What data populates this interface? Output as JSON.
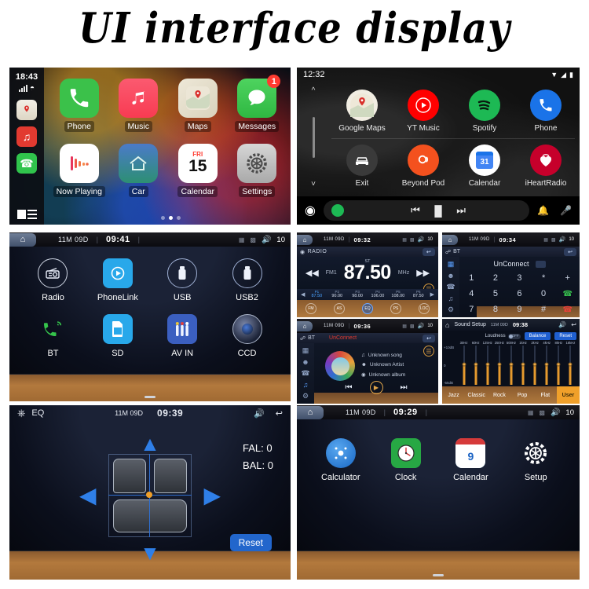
{
  "title": "UI interface display",
  "carplay": {
    "time": "18:43",
    "rail_icons": [
      "maps-icon",
      "netease-music-icon",
      "phone-icon",
      "list-icon"
    ],
    "apps": [
      {
        "label": "Phone",
        "icon": "phone-icon",
        "color": "#3bc14a",
        "badge": null
      },
      {
        "label": "Music",
        "icon": "music-note-icon",
        "color": "#fa4a5c",
        "badge": null
      },
      {
        "label": "Maps",
        "icon": "map-pin-icon",
        "color": "#f3efe4",
        "badge": null
      },
      {
        "label": "Messages",
        "icon": "chat-bubble-icon",
        "color": "#3bc14a",
        "badge": "1"
      },
      {
        "label": "Now Playing",
        "icon": "waveform-icon",
        "color": "#ffffff",
        "badge": null
      },
      {
        "label": "Car",
        "icon": "home-car-icon",
        "color": "#2f8f6a",
        "badge": null
      },
      {
        "label": "Calendar",
        "icon": "calendar-icon",
        "color": "#ffffff",
        "badge": null
      },
      {
        "label": "Settings",
        "icon": "gear-icon",
        "color": "#b9b9b9",
        "badge": null
      }
    ],
    "calendar_day_name": "FRI",
    "calendar_day_number": "15",
    "page_dots": 3,
    "active_dot": 2
  },
  "androidauto": {
    "time": "12:32",
    "status_icons": [
      "wifi-icon",
      "signal-icon",
      "battery-icon"
    ],
    "apps": [
      {
        "label": "Google Maps",
        "icon": "google-maps-icon",
        "color": "#f1ede2"
      },
      {
        "label": "YT Music",
        "icon": "yt-music-icon",
        "color": "#ff0000"
      },
      {
        "label": "Spotify",
        "icon": "spotify-icon",
        "color": "#1db954"
      },
      {
        "label": "Phone",
        "icon": "phone-icon",
        "color": "#1a73e8"
      },
      {
        "label": "Exit",
        "icon": "car-exit-icon",
        "color": "#3a3a3a"
      },
      {
        "label": "Beyond Pod",
        "icon": "beyond-pod-icon",
        "color": "#f4511e"
      },
      {
        "label": "Calendar",
        "icon": "google-calendar-icon",
        "color": "#ffffff"
      },
      {
        "label": "iHeartRadio",
        "icon": "iheartradio-icon",
        "color": "#c6002b"
      }
    ],
    "calendar_day_number": "31",
    "controls": [
      "assistant-icon",
      "spotify-icon",
      "previous-icon",
      "pause-icon",
      "next-icon"
    ],
    "right_controls": [
      "bell-icon",
      "mic-icon"
    ]
  },
  "home": {
    "status": {
      "date": "11M 09D",
      "time": "09:41",
      "volume": "10",
      "home_icon": "home-icon",
      "sd_icon": "sd-card-icon",
      "usb_icon": "usb-icon",
      "volume_icon": "volume-icon"
    },
    "apps": [
      {
        "label": "Radio",
        "icon": "radio-icon"
      },
      {
        "label": "PhoneLink",
        "icon": "phonelink-icon"
      },
      {
        "label": "USB",
        "icon": "usb-icon"
      },
      {
        "label": "USB2",
        "icon": "usb2-icon"
      },
      {
        "label": "BT",
        "icon": "bluetooth-phone-icon"
      },
      {
        "label": "SD",
        "icon": "sd-card-icon"
      },
      {
        "label": "AV IN",
        "icon": "av-in-icon"
      },
      {
        "label": "CCD",
        "icon": "camera-icon"
      }
    ]
  },
  "radio": {
    "status": {
      "date": "11M 09D",
      "time": "09:32",
      "volume": "10"
    },
    "screen_title": "RADIO",
    "back_icon": "back-icon",
    "stereo_label": "ST",
    "frequency": "87.50",
    "band": "FM1",
    "unit": "MHz",
    "prev_icon": "prev-icon",
    "next_icon": "next-icon",
    "presets": [
      {
        "name": "P1",
        "value": "87.50",
        "active": true
      },
      {
        "name": "P2",
        "value": "90.00",
        "active": false
      },
      {
        "name": "P3",
        "value": "98.00",
        "active": false
      },
      {
        "name": "P4",
        "value": "106.00",
        "active": false
      },
      {
        "name": "P5",
        "value": "108.00",
        "active": false
      },
      {
        "name": "P6",
        "value": "87.50",
        "active": false
      }
    ],
    "buttons": [
      "FM",
      "AS",
      "EQ",
      "PS",
      "LOC"
    ]
  },
  "btdial": {
    "status": {
      "date": "11M 09D",
      "time": "09:34",
      "volume": "10"
    },
    "screen_title": "BT",
    "connection_status": "UnConnect",
    "rail": [
      "keypad-icon",
      "contacts-icon",
      "call-log-icon",
      "music-icon",
      "settings-icon"
    ],
    "keys": [
      "1",
      "2",
      "3",
      "*",
      "+",
      "4",
      "5",
      "6",
      "0",
      "call",
      "7",
      "8",
      "9",
      "#",
      "hangup"
    ],
    "delete_icon": "backspace-icon"
  },
  "btmusic": {
    "status": {
      "date": "11M 09D",
      "time": "09:36",
      "volume": "10"
    },
    "screen_title": "BT",
    "connection_status": "UnConnect",
    "song": "Unknown song",
    "artist": "Unknown Artist",
    "album": "Unknown album",
    "controls": [
      "previous-icon",
      "play-icon",
      "next-icon"
    ]
  },
  "sound": {
    "panel_title": "Sound Setup",
    "status": {
      "date": "11M 09D",
      "time": "09:38"
    },
    "loudness_label": "Loudness",
    "loudness_state": "OFF",
    "balance_label": "Balance",
    "reset_label": "Reset",
    "scale": {
      "top": "+10dB",
      "mid": "0",
      "bottom": "-55dB"
    },
    "bands": [
      "30Hz",
      "60Hz",
      "125Hz",
      "250Hz",
      "500Hz",
      "1kHz",
      "2kHz",
      "4kHz",
      "8kHz",
      "16kHz"
    ],
    "band_values": [
      52,
      52,
      52,
      52,
      52,
      52,
      52,
      52,
      52,
      52
    ],
    "presets": [
      {
        "label": "Jazz",
        "active": false
      },
      {
        "label": "Classic",
        "active": false
      },
      {
        "label": "Rock",
        "active": false
      },
      {
        "label": "Pop",
        "active": false
      },
      {
        "label": "Flat",
        "active": false
      },
      {
        "label": "User",
        "active": true
      }
    ]
  },
  "fader": {
    "screen_title": "EQ",
    "status": {
      "date": "11M 09D",
      "time": "09:39"
    },
    "home_icon": "home-icon",
    "volume_icon": "volume-icon",
    "back_icon": "back-icon",
    "fade_label": "FAL: 0",
    "balance_label": "BAL: 0",
    "reset_label": "Reset",
    "arrows": [
      "up-arrow-icon",
      "down-arrow-icon",
      "left-arrow-icon",
      "right-arrow-icon"
    ]
  },
  "tools": {
    "status": {
      "date": "11M 09D",
      "time": "09:29",
      "volume": "10"
    },
    "apps": [
      {
        "label": "Calculator",
        "icon": "calculator-icon"
      },
      {
        "label": "Clock",
        "icon": "clock-icon"
      },
      {
        "label": "Calendar",
        "icon": "calendar-icon",
        "day": "9"
      },
      {
        "label": "Setup",
        "icon": "setup-gear-icon"
      }
    ]
  }
}
